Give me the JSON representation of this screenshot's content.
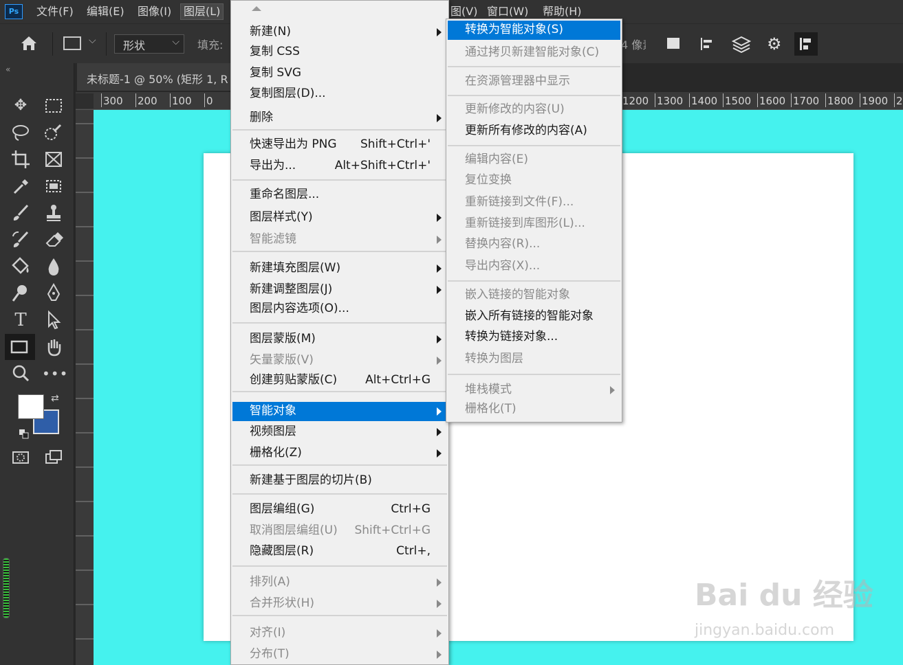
{
  "app": {
    "logo": "Ps"
  },
  "menubar": {
    "file": "文件(F)",
    "edit": "编辑(E)",
    "image": "图像(I)",
    "layer": "图层(L)",
    "view": "图(V)",
    "window": "窗口(W)",
    "help": "帮助(H)"
  },
  "options": {
    "mode": "形状",
    "fill_label": "填充:",
    "units_fragment": "4 像素"
  },
  "doc_tab": {
    "title": "未标题-1 @ 50% (矩形 1, R"
  },
  "ruler": {
    "left_labels": [
      "300",
      "200",
      "100",
      "0"
    ],
    "right_labels": [
      "1200",
      "1300",
      "1400",
      "1500",
      "1600",
      "1700",
      "1800",
      "1900",
      "20"
    ]
  },
  "colors": {
    "foreground": "#ffffff",
    "background": "#2f5ea8",
    "canvas_bg": "#45f2ee",
    "highlight": "#0078d7"
  },
  "layer_menu": {
    "items": [
      {
        "label": "新建(N)",
        "shortcut": "",
        "submenu": true,
        "disabled": false
      },
      {
        "label": "复制 CSS",
        "shortcut": "",
        "submenu": false,
        "disabled": false
      },
      {
        "label": "复制 SVG",
        "shortcut": "",
        "submenu": false,
        "disabled": false
      },
      {
        "label": "复制图层(D)...",
        "shortcut": "",
        "submenu": false,
        "disabled": false
      },
      {
        "label": "删除",
        "shortcut": "",
        "submenu": true,
        "disabled": false
      },
      {
        "label": "快速导出为 PNG",
        "shortcut": "Shift+Ctrl+'",
        "submenu": false,
        "disabled": false
      },
      {
        "label": "导出为...",
        "shortcut": "Alt+Shift+Ctrl+'",
        "submenu": false,
        "disabled": false
      },
      {
        "label": "重命名图层...",
        "shortcut": "",
        "submenu": false,
        "disabled": false
      },
      {
        "label": "图层样式(Y)",
        "shortcut": "",
        "submenu": true,
        "disabled": false
      },
      {
        "label": "智能滤镜",
        "shortcut": "",
        "submenu": true,
        "disabled": true
      },
      {
        "label": "新建填充图层(W)",
        "shortcut": "",
        "submenu": true,
        "disabled": false
      },
      {
        "label": "新建调整图层(J)",
        "shortcut": "",
        "submenu": true,
        "disabled": false
      },
      {
        "label": "图层内容选项(O)...",
        "shortcut": "",
        "submenu": false,
        "disabled": false
      },
      {
        "label": "图层蒙版(M)",
        "shortcut": "",
        "submenu": true,
        "disabled": false
      },
      {
        "label": "矢量蒙版(V)",
        "shortcut": "",
        "submenu": true,
        "disabled": true
      },
      {
        "label": "创建剪贴蒙版(C)",
        "shortcut": "Alt+Ctrl+G",
        "submenu": false,
        "disabled": false
      },
      {
        "label": "智能对象",
        "shortcut": "",
        "submenu": true,
        "disabled": false,
        "highlighted": true
      },
      {
        "label": "视频图层",
        "shortcut": "",
        "submenu": true,
        "disabled": false
      },
      {
        "label": "栅格化(Z)",
        "shortcut": "",
        "submenu": true,
        "disabled": false
      },
      {
        "label": "新建基于图层的切片(B)",
        "shortcut": "",
        "submenu": false,
        "disabled": false
      },
      {
        "label": "图层编组(G)",
        "shortcut": "Ctrl+G",
        "submenu": false,
        "disabled": false
      },
      {
        "label": "取消图层编组(U)",
        "shortcut": "Shift+Ctrl+G",
        "submenu": false,
        "disabled": true
      },
      {
        "label": "隐藏图层(R)",
        "shortcut": "Ctrl+,",
        "submenu": false,
        "disabled": false
      },
      {
        "label": "排列(A)",
        "shortcut": "",
        "submenu": true,
        "disabled": true
      },
      {
        "label": "合并形状(H)",
        "shortcut": "",
        "submenu": true,
        "disabled": true
      },
      {
        "label": "对齐(I)",
        "shortcut": "",
        "submenu": true,
        "disabled": true
      },
      {
        "label": "分布(T)",
        "shortcut": "",
        "submenu": true,
        "disabled": true
      }
    ]
  },
  "smart_object_menu": {
    "items": [
      {
        "label": "转换为智能对象(S)",
        "submenu": false,
        "disabled": false,
        "highlighted": true
      },
      {
        "label": "通过拷贝新建智能对象(C)",
        "submenu": false,
        "disabled": true
      },
      {
        "label": "在资源管理器中显示",
        "submenu": false,
        "disabled": true
      },
      {
        "label": "更新修改的内容(U)",
        "submenu": false,
        "disabled": true
      },
      {
        "label": "更新所有修改的内容(A)",
        "submenu": false,
        "disabled": false
      },
      {
        "label": "编辑内容(E)",
        "submenu": false,
        "disabled": true
      },
      {
        "label": "复位变换",
        "submenu": false,
        "disabled": true
      },
      {
        "label": "重新链接到文件(F)...",
        "submenu": false,
        "disabled": true
      },
      {
        "label": "重新链接到库图形(L)...",
        "submenu": false,
        "disabled": true
      },
      {
        "label": "替换内容(R)...",
        "submenu": false,
        "disabled": true
      },
      {
        "label": "导出内容(X)...",
        "submenu": false,
        "disabled": true
      },
      {
        "label": "嵌入链接的智能对象",
        "submenu": false,
        "disabled": true
      },
      {
        "label": "嵌入所有链接的智能对象",
        "submenu": false,
        "disabled": false
      },
      {
        "label": "转换为链接对象...",
        "submenu": false,
        "disabled": false
      },
      {
        "label": "转换为图层",
        "submenu": false,
        "disabled": true
      },
      {
        "label": "堆栈模式",
        "submenu": true,
        "disabled": true
      },
      {
        "label": "栅格化(T)",
        "submenu": false,
        "disabled": true
      }
    ]
  },
  "watermark": {
    "brand": "Bai du 经验",
    "url": "jingyan.baidu.com"
  }
}
